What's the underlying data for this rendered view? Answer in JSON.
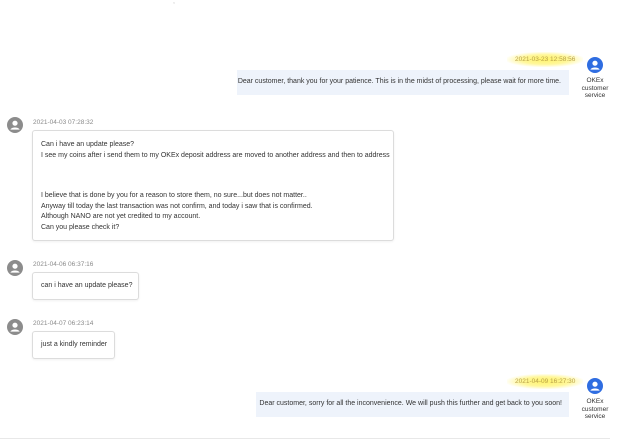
{
  "header": {
    "partial_text": ","
  },
  "messages": [
    {
      "sender": "agent",
      "timestamp": "2021-03-23 12:58:56",
      "text": "Dear customer, thank you for your patience. This is in the midst of processing, please wait for more time.",
      "avatar_label": [
        "OKEx",
        "customer",
        "service"
      ]
    },
    {
      "sender": "user",
      "timestamp": "2021-04-03 07:28:32",
      "lines": [
        "Can i have an update please?",
        "I see my coins after i send them to my OKEx deposit address are moved to another address and then to address",
        "",
        "",
        "",
        "I believe that is done by you for a reason to store them, no sure...but does not matter..",
        "Anyway till today the last transaction was not confirm, and today i saw that is confirmed.",
        "Although NANO are not yet credited to my account.",
        "Can you please check it?"
      ]
    },
    {
      "sender": "user",
      "timestamp": "2021-04-06 06:37:16",
      "lines": [
        "can i have an update please?"
      ]
    },
    {
      "sender": "user",
      "timestamp": "2021-04-07 06:23:14",
      "lines": [
        "just a kindly reminder"
      ]
    },
    {
      "sender": "agent",
      "timestamp": "2021-04-09 16:27:30",
      "text": "Dear customer, sorry for all the inconvenience. We will push this further and get back to you soon!",
      "avatar_label": [
        "OKEx",
        "customer",
        "service"
      ]
    }
  ],
  "colors": {
    "agent_bubble": "#eef3fb",
    "user_bubble_border": "#dcdcdc",
    "agent_avatar": "#2f6de1",
    "user_avatar": "#8c8c8c",
    "timestamp_highlight": "#fff36b"
  }
}
